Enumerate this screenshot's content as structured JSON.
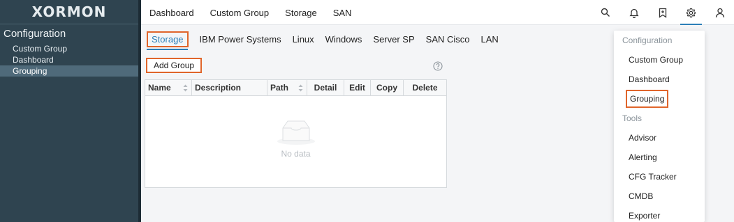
{
  "app": {
    "logo": "XORMON"
  },
  "sidebar": {
    "title": "Configuration",
    "items": [
      {
        "label": "Custom Group"
      },
      {
        "label": "Dashboard"
      },
      {
        "label": "Grouping",
        "active": true
      }
    ]
  },
  "topnav": {
    "items": [
      {
        "label": "Dashboard"
      },
      {
        "label": "Custom Group"
      },
      {
        "label": "Storage"
      },
      {
        "label": "SAN"
      }
    ],
    "icons": [
      "search-icon",
      "bell-icon",
      "bookmark-icon",
      "gear-icon",
      "user-icon"
    ],
    "active_icon": "gear-icon"
  },
  "subtabs": {
    "items": [
      {
        "label": "Storage",
        "active": true
      },
      {
        "label": "IBM Power Systems"
      },
      {
        "label": "Linux"
      },
      {
        "label": "Windows"
      },
      {
        "label": "Server SP"
      },
      {
        "label": "SAN Cisco"
      },
      {
        "label": "LAN"
      }
    ]
  },
  "toolbar": {
    "add_group_label": "Add Group"
  },
  "table": {
    "columns": [
      {
        "label": "Name",
        "sortable": true
      },
      {
        "label": "Description"
      },
      {
        "label": "Path",
        "sortable": true
      },
      {
        "label": "Detail"
      },
      {
        "label": "Edit"
      },
      {
        "label": "Copy"
      },
      {
        "label": "Delete"
      }
    ],
    "empty_text": "No data"
  },
  "dropdown": {
    "sections": [
      {
        "header": "Configuration",
        "items": [
          {
            "label": "Custom Group"
          },
          {
            "label": "Dashboard"
          },
          {
            "label": "Grouping",
            "highlighted": true
          }
        ]
      },
      {
        "header": "Tools",
        "items": [
          {
            "label": "Advisor"
          },
          {
            "label": "Alerting"
          },
          {
            "label": "CFG Tracker"
          },
          {
            "label": "CMDB"
          },
          {
            "label": "Exporter"
          }
        ]
      }
    ]
  },
  "colors": {
    "sidebar_bg": "#2f4450",
    "accent": "#2c7fb8",
    "highlight_border": "#e0652b"
  }
}
